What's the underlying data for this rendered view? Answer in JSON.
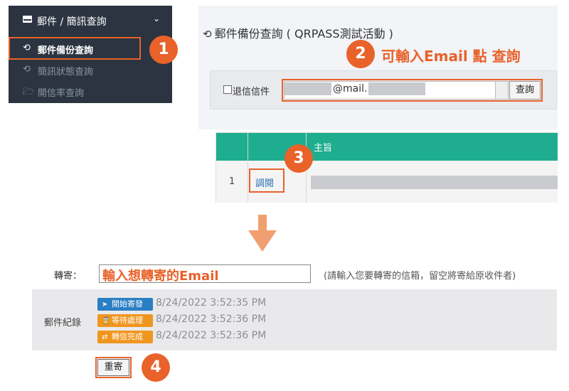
{
  "sidebar": {
    "header_label": "郵件 / 簡訊查詢",
    "items": [
      {
        "label": "郵件備份查詢",
        "icon": "history-icon",
        "active": true
      },
      {
        "label": "簡訊狀態查詢",
        "icon": "history-icon",
        "active": false
      },
      {
        "label": "開信率查詢",
        "icon": "folder-open-icon",
        "active": false
      }
    ]
  },
  "badges": {
    "step1": "1",
    "step2": "2",
    "step3": "3",
    "step4": "4"
  },
  "search_page": {
    "title": "郵件備份查詢 ( QRPASS測試活動 )",
    "instruction": "可輸入Email 點 查詢",
    "bounce_checkbox_label": "退信信件",
    "email_visible_part": "@mail.",
    "query_button": "查詢"
  },
  "table": {
    "header_subject": "主旨",
    "rows": [
      {
        "num": "1",
        "action": "調閱"
      }
    ]
  },
  "forward_form": {
    "label": "轉寄：",
    "input_value": "輸入想轉寄的Email",
    "hint": "(請輸入您要轉寄的信箱，留空將寄給原收件者)",
    "log_label": "郵件紀錄",
    "log": [
      {
        "status": "開始寄發",
        "time": "8/24/2022 3:52:35 PM",
        "color": "#2a7ec4",
        "icon": "paper-plane-icon"
      },
      {
        "status": "等待處理",
        "time": "8/24/2022 3:52:36 PM",
        "color": "#f0961f",
        "icon": "hourglass-icon"
      },
      {
        "status": "轉信完成",
        "time": "8/24/2022 3:52:36 PM",
        "color": "#f0961f",
        "icon": "shuffle-icon"
      }
    ],
    "resend_button": "重寄"
  },
  "colors": {
    "accent": "#e8622a",
    "table_header": "#1fad8f",
    "sidebar_bg": "#2b3440"
  }
}
